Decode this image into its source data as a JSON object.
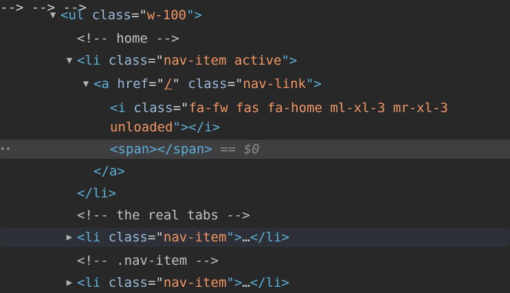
{
  "rows": [
    {
      "id": "ul",
      "indent_label": "ul",
      "toggle": "▼",
      "parts": [
        "<",
        "ul",
        "class",
        "=\"",
        "w-100",
        "\">"
      ]
    }
  ],
  "ul_row": {
    "toggle": "▼",
    "open": "<",
    "tag": "ul",
    "attr": "class",
    "eq": "=\"",
    "value": "w-100",
    "close": "\">"
  },
  "comment_home": "<!-- home -->",
  "li_active": {
    "toggle": "▼",
    "open": "<",
    "tag": "li",
    "attr": "class",
    "eq": "=\"",
    "value": "nav-item active",
    "close": "\">"
  },
  "a_row": {
    "toggle": "▼",
    "open": "<",
    "tag": "a",
    "attr1": "href",
    "eq1": "=\"",
    "value1": "/",
    "close1": "\"",
    "attr2": "class",
    "eq2": "=\"",
    "value2": "nav-link",
    "close2": "\">"
  },
  "i_row": {
    "open": "<",
    "tag": "i",
    "attr": "class",
    "eq": "=\"",
    "value_line1": "fa-fw fas fa-home ml-xl-3 mr-xl-3",
    "value_line2": "unloaded",
    "close": "\"></",
    "end_tag": "i",
    "end_close": ">"
  },
  "span_row": {
    "dots": "••",
    "open": "<",
    "tag": "span",
    "mid": "></",
    "end_tag": "span",
    "close": ">",
    "eq_marker": "==",
    "dollar": "$0"
  },
  "a_close": {
    "open": "</",
    "tag": "a",
    "close": ">"
  },
  "li_close": {
    "open": "</",
    "tag": "li",
    "close": ">"
  },
  "comment_tabs": "<!-- the real tabs -->",
  "li_nav_1": {
    "toggle": "▶",
    "open": "<",
    "tag": "li",
    "attr": "class",
    "eq": "=\"",
    "value": "nav-item",
    "close": "\">",
    "ellipsis": "…",
    "end_open": "</",
    "end_tag": "li",
    "end_close": ">"
  },
  "comment_navitem": "<!-- .nav-item -->",
  "li_nav_2": {
    "toggle": "▶",
    "open": "<",
    "tag": "li",
    "attr": "class",
    "eq": "=\"",
    "value": "nav-item",
    "close": "\">",
    "ellipsis": "…",
    "end_open": "</",
    "end_tag": "li",
    "end_close": ">"
  }
}
